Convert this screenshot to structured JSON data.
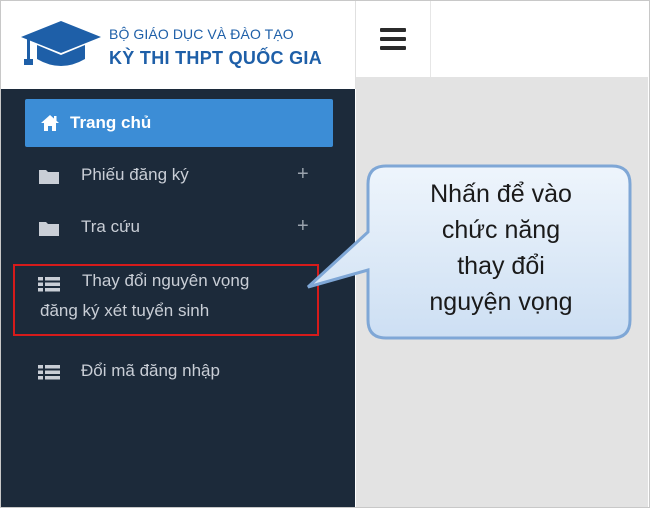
{
  "header": {
    "org_name": "BỘ GIÁO DỤC VÀ ĐÀO TẠO",
    "app_title": "KỲ THI THPT QUỐC GIA",
    "logo_icon": "graduation-cap-icon",
    "menu_icon": "hamburger-menu-icon"
  },
  "sidebar": {
    "items": [
      {
        "label": "Trang chủ",
        "icon": "home-icon",
        "active": true
      },
      {
        "label": "Phiếu đăng ký",
        "icon": "folder-icon",
        "expandable": true,
        "expand_symbol": "+"
      },
      {
        "label": "Tra cứu",
        "icon": "folder-icon",
        "expandable": true,
        "expand_symbol": "+"
      },
      {
        "label_line1": "Thay đổi nguyên vọng",
        "label_line2": "đăng ký xét tuyển sinh",
        "icon": "list-icon",
        "highlighted": true
      },
      {
        "label": "Đổi mã đăng nhập",
        "icon": "list-icon"
      }
    ]
  },
  "callout": {
    "lines": [
      "Nhấn để vào",
      "chức năng",
      "thay đổi",
      "nguyện vọng"
    ]
  },
  "colors": {
    "brand_blue": "#1e5fa8",
    "sidebar_bg": "#1c2a3a",
    "active_item": "#3c8dd6",
    "highlight_border": "#d51b1b",
    "callout_fill": "#dce9f7",
    "callout_border": "#7fa7d6"
  }
}
